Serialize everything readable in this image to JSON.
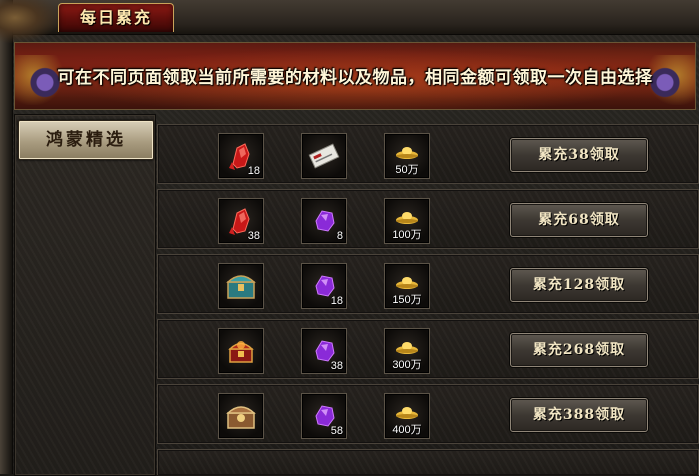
{
  "window": {
    "title": "每日累充"
  },
  "banner": {
    "text": "可在不同页面领取当前所需要的材料以及物品，相同金额可领取一次自由选择"
  },
  "sidebar": {
    "tabs": [
      {
        "label": "鸿蒙精选",
        "active": true
      }
    ]
  },
  "rows": [
    {
      "items": [
        {
          "icon": "red-gem-icon",
          "count": "18"
        },
        {
          "icon": "scroll-icon",
          "count": ""
        },
        {
          "icon": "gold-ingot-icon",
          "count": "50万"
        }
      ],
      "button": "累充38领取"
    },
    {
      "items": [
        {
          "icon": "red-gem-icon",
          "count": "38"
        },
        {
          "icon": "purple-crystal-icon",
          "count": "8"
        },
        {
          "icon": "gold-ingot-icon",
          "count": "100万"
        }
      ],
      "button": "累充68领取"
    },
    {
      "items": [
        {
          "icon": "teal-chest-icon",
          "count": ""
        },
        {
          "icon": "purple-crystal-icon",
          "count": "18"
        },
        {
          "icon": "gold-ingot-icon",
          "count": "150万"
        }
      ],
      "button": "累充128领取"
    },
    {
      "items": [
        {
          "icon": "red-chest-icon",
          "count": ""
        },
        {
          "icon": "purple-crystal-icon",
          "count": "38"
        },
        {
          "icon": "gold-ingot-icon",
          "count": "300万"
        }
      ],
      "button": "累充268领取"
    },
    {
      "items": [
        {
          "icon": "bronze-chest-icon",
          "count": ""
        },
        {
          "icon": "purple-crystal-icon",
          "count": "58"
        },
        {
          "icon": "gold-ingot-icon",
          "count": "400万"
        }
      ],
      "button": "累充388领取"
    }
  ],
  "colors": {
    "title_tab": "#8c1a14",
    "button_text": "#f2e6c4",
    "accent_gold": "#e8b83a"
  }
}
